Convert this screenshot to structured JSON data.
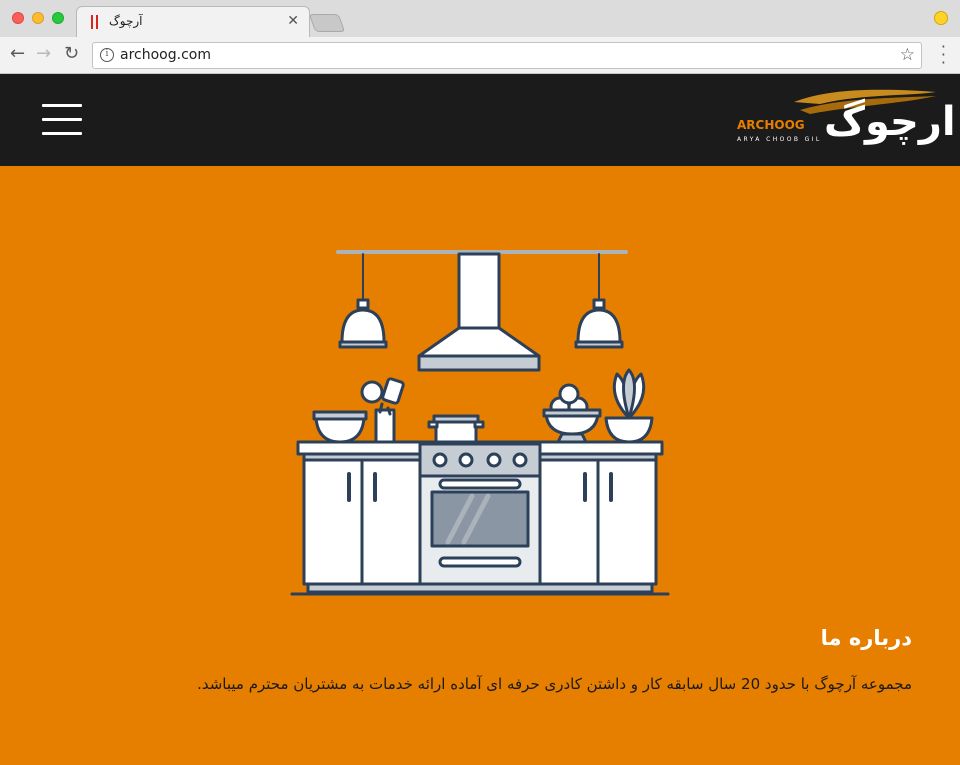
{
  "browser": {
    "tab_title": "آرچوگ",
    "url": "archoog.com"
  },
  "header": {
    "logo": {
      "farsi_text": "ارچوگ",
      "latin_text": "ARCHOOG",
      "tagline": "ARYA CHOOB GIL"
    }
  },
  "about": {
    "title": "درباره ما",
    "text": "مجموعه آرچوگ با حدود 20 سال سابقه کار و داشتن کادری حرفه ای آماده ارائه خدمات به مشتریان محترم میباشد."
  },
  "colors": {
    "accent": "#e67e00",
    "header_bg": "#1b1b1b",
    "illustration_outline": "#2c4159"
  }
}
